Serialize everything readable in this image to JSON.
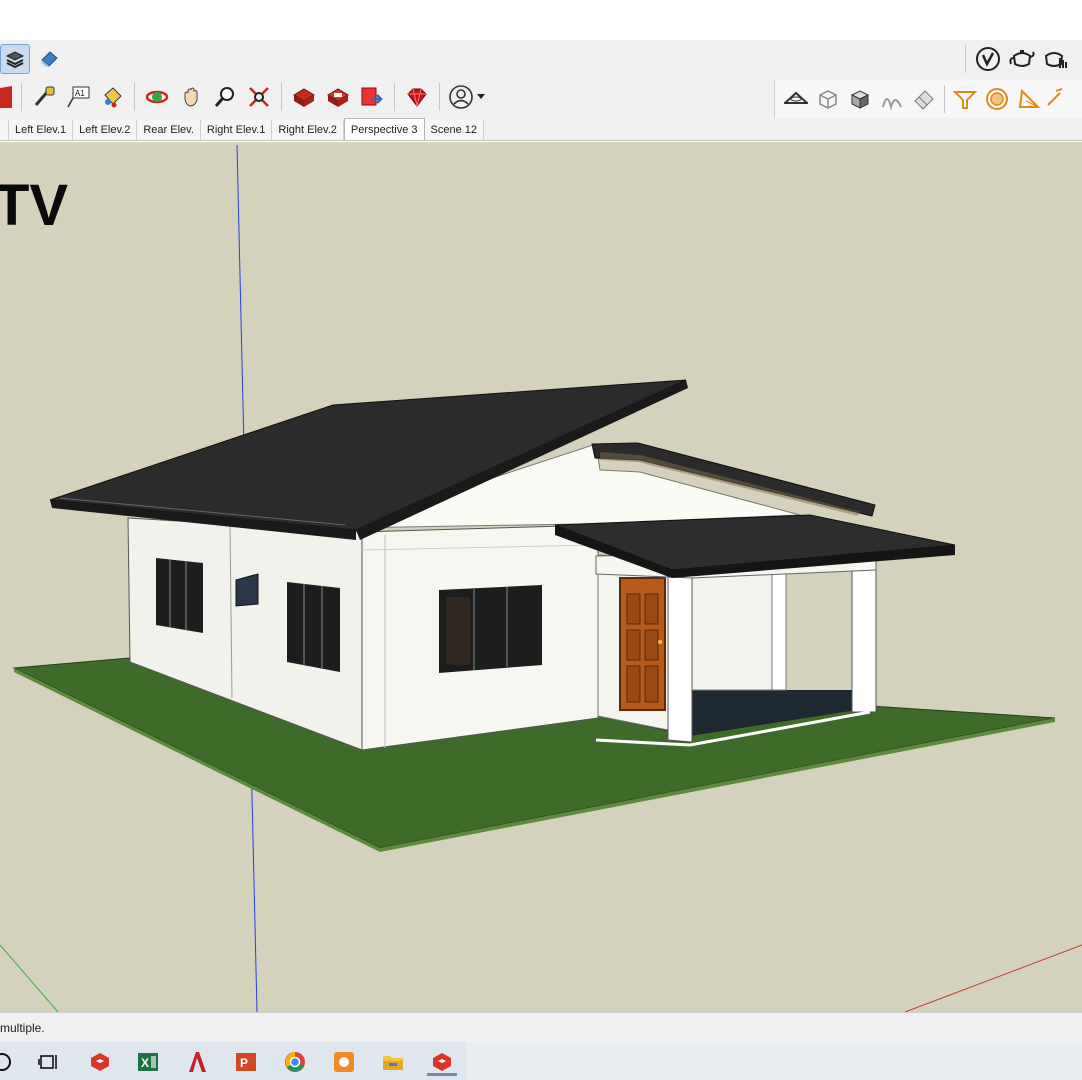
{
  "toolbar": {
    "top_row_icons": [
      "layers-icon",
      "eraser-icon"
    ],
    "main_icons": [
      "red-arrow-icon",
      "tape-measure-icon",
      "text-label-icon",
      "paint-bucket-icon",
      "orbit-icon",
      "pan-icon",
      "zoom-icon",
      "zoom-extents-icon",
      "warehouse-icon",
      "extension-warehouse-icon",
      "send-to-layout-icon",
      "ruby-icon",
      "user-account-icon"
    ],
    "right_top_icons": [
      "vray-check-icon",
      "teapot-icon",
      "interactive-render-icon"
    ],
    "right_group_icons": [
      "section-plane-icon",
      "cube-outline-icon",
      "cube-solid-icon",
      "sandbox-icon",
      "eraser-smooth-icon",
      "funnel-icon",
      "circle-target-icon",
      "cone-icon",
      "pencil-icon"
    ]
  },
  "tabs": [
    {
      "label": "Left Elev.1",
      "active": false
    },
    {
      "label": "Left Elev.2",
      "active": false
    },
    {
      "label": "Rear Elev.",
      "active": false
    },
    {
      "label": "Right Elev.1",
      "active": false
    },
    {
      "label": "Right Elev.2",
      "active": false
    },
    {
      "label": "Perspective 3",
      "active": true
    },
    {
      "label": "Scene 12",
      "active": false
    }
  ],
  "viewport": {
    "title_text": "TV",
    "background": "#d4d2bc"
  },
  "status": {
    "text": "multiple."
  },
  "taskbar": {
    "icons": [
      "search-icon",
      "task-view-icon",
      "sketchup-icon",
      "excel-icon",
      "autocad-icon",
      "powerpoint-icon",
      "chrome-icon",
      "app-orange-icon",
      "file-explorer-icon",
      "sketchup-active-icon"
    ]
  },
  "colors": {
    "roof": "#2b2b2b",
    "wall": "#f4f4ef",
    "grass": "#3f6b2a",
    "door": "#b75a1c",
    "porch_floor": "#1d2830",
    "sky": "#d4d2bc"
  }
}
